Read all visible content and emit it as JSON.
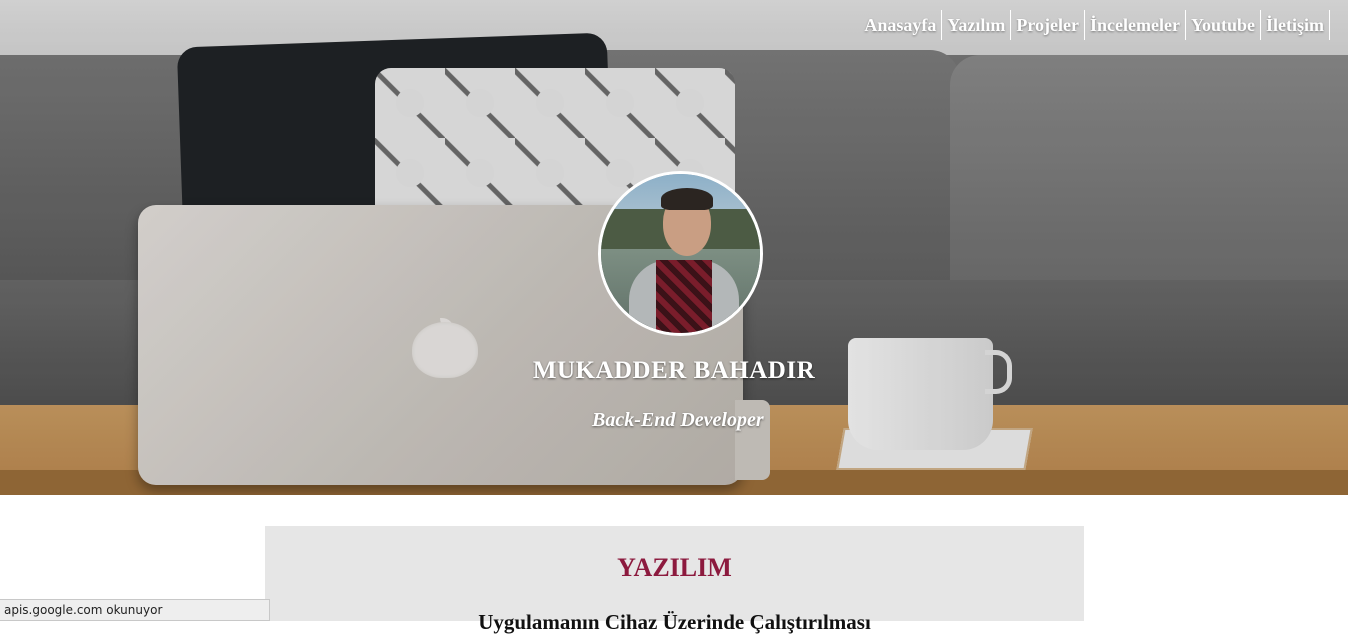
{
  "nav": {
    "items": [
      {
        "label": "Anasayfa"
      },
      {
        "label": "Yazılım"
      },
      {
        "label": "Projeler"
      },
      {
        "label": "İncelemeler"
      },
      {
        "label": "Youtube"
      },
      {
        "label": "İletişim"
      }
    ]
  },
  "profile": {
    "name": "MUKADDER BAHADIR",
    "role": "Back-End Developer"
  },
  "section": {
    "title": "YAZILIM",
    "article_title": "Uygulamanın Cihaz Üzerinde Çalıştırılması"
  },
  "status_bar": {
    "text": "apis.google.com okunuyor"
  },
  "colors": {
    "section_title": "#8c1a3e",
    "panel_bg": "#e6e6e6"
  }
}
